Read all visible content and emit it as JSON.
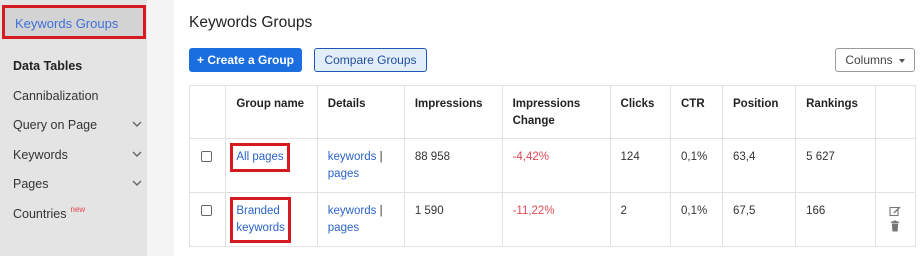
{
  "sidebar": {
    "active_item": "Keywords Groups",
    "heading": "Data Tables",
    "items": [
      {
        "label": "Cannibalization",
        "has_chevron": false
      },
      {
        "label": "Query on Page",
        "has_chevron": true
      },
      {
        "label": "Keywords",
        "has_chevron": true
      },
      {
        "label": "Pages",
        "has_chevron": true
      },
      {
        "label": "Countries",
        "has_chevron": false,
        "badge": "new"
      }
    ]
  },
  "main": {
    "title": "Keywords Groups",
    "create_button": "+ Create a Group",
    "compare_button": "Compare Groups",
    "columns_button": "Columns",
    "table": {
      "headers": [
        "Group name",
        "Details",
        "Impressions",
        "Impressions Change",
        "Clicks",
        "CTR",
        "Position",
        "Rankings"
      ],
      "rows": [
        {
          "group_name": "All pages",
          "details_keywords": "keywords",
          "details_sep": "|",
          "details_pages": "pages",
          "impressions": "88 958",
          "impressions_change": "-4,42%",
          "clicks": "124",
          "ctr": "0,1%",
          "position": "63,4",
          "rankings": "5 627"
        },
        {
          "group_name_line1": "Branded",
          "group_name_line2": "keywords",
          "details_keywords": "keywords",
          "details_sep": "|",
          "details_pages": "pages",
          "impressions": "1 590",
          "impressions_change": "-11,22%",
          "clicks": "2",
          "ctr": "0,1%",
          "position": "67,5",
          "rankings": "166"
        }
      ]
    }
  },
  "colors": {
    "accent": "#1b6ee0",
    "highlight_box": "#d71920",
    "negative": "#e04a58",
    "link": "#2b63c9"
  },
  "icons": [
    "chevron-down-icon",
    "edit-icon",
    "trash-icon"
  ]
}
